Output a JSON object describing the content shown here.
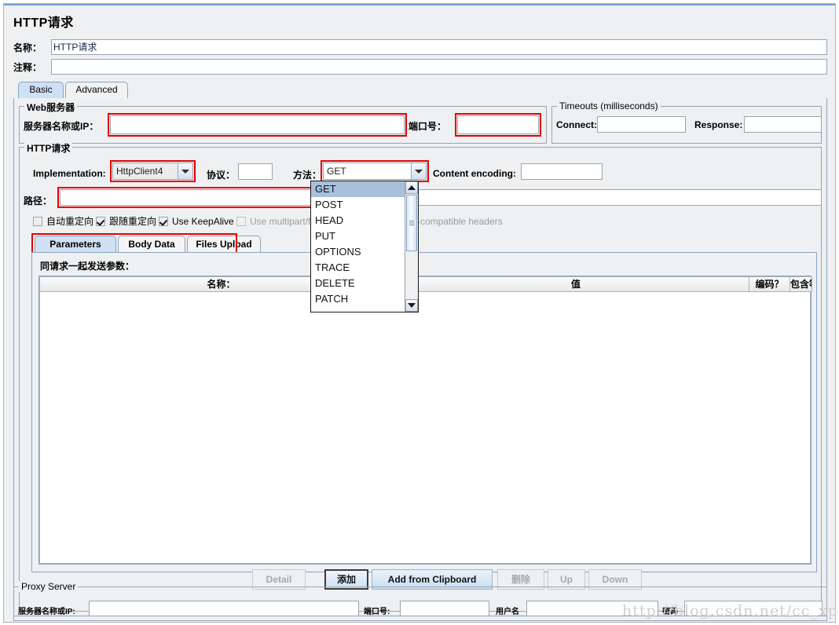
{
  "window": {
    "title": "HTTP请求"
  },
  "header": {
    "name_label": "名称：",
    "name_value": "HTTP请求",
    "comment_label": "注释：",
    "comment_value": ""
  },
  "tabs": [
    {
      "label": "Basic",
      "selected": true
    },
    {
      "label": "Advanced",
      "selected": false
    }
  ],
  "web_server": {
    "group_title": "Web服务器",
    "server_label": "服务器名称或IP：",
    "server_value": "",
    "port_label": "端口号：",
    "port_value": ""
  },
  "timeouts": {
    "group_title": "Timeouts (milliseconds)",
    "connect_label": "Connect:",
    "connect_value": "",
    "response_label": "Response:",
    "response_value": ""
  },
  "http_request": {
    "group_title": "HTTP请求",
    "implementation_label": "Implementation:",
    "implementation_value": "HttpClient4",
    "protocol_label": "协议：",
    "protocol_value": "",
    "method_label": "方法：",
    "method_value": "GET",
    "content_encoding_label": "Content encoding:",
    "content_encoding_value": "",
    "path_label": "路径：",
    "path_value": "",
    "checkboxes": [
      {
        "label": "自动重定向",
        "checked": false,
        "disabled": false
      },
      {
        "label": "跟随重定向",
        "checked": true,
        "disabled": false
      },
      {
        "label": "Use KeepAlive",
        "checked": true,
        "disabled": false
      },
      {
        "label": "Use multipart/form-data",
        "checked": false,
        "disabled": true
      },
      {
        "label": "Browser-compatible headers",
        "checked": false,
        "disabled": true
      }
    ]
  },
  "method_dropdown": {
    "options": [
      "GET",
      "POST",
      "HEAD",
      "PUT",
      "OPTIONS",
      "TRACE",
      "DELETE",
      "PATCH"
    ],
    "selected": "GET",
    "scroll_up_icon": "triangle-up-icon",
    "scroll_down_icon": "triangle-down-icon"
  },
  "param_tabs": [
    {
      "label": "Parameters",
      "selected": true
    },
    {
      "label": "Body Data",
      "selected": false
    },
    {
      "label": "Files Upload",
      "selected": false
    }
  ],
  "params_panel": {
    "section_label": "同请求一起发送参数：",
    "columns": [
      "名称：",
      "值",
      "编码？",
      "包含等于？"
    ],
    "rows": []
  },
  "buttons": [
    {
      "label": "Detail",
      "state": "disabled"
    },
    {
      "label": "添加",
      "state": "focused"
    },
    {
      "label": "Add from Clipboard",
      "state": "enabled"
    },
    {
      "label": "删除",
      "state": "disabled"
    },
    {
      "label": "Up",
      "state": "disabled"
    },
    {
      "label": "Down",
      "state": "disabled"
    }
  ],
  "proxy": {
    "group_title": "Proxy Server",
    "server_label": "服务器名称或IP:",
    "server_value": "",
    "port_label": "端口号:",
    "port_value": "",
    "user_label": "用户名",
    "user_value": "",
    "password_label": "密码",
    "password_value": ""
  },
  "watermark": {
    "text": "http://blog.csdn.net/cc_xp"
  },
  "colors": {
    "highlight": "#e60000",
    "selected_tab": "#cfe0f5",
    "panel_bg": "#eef0f2",
    "border": "#8ba3c0"
  }
}
